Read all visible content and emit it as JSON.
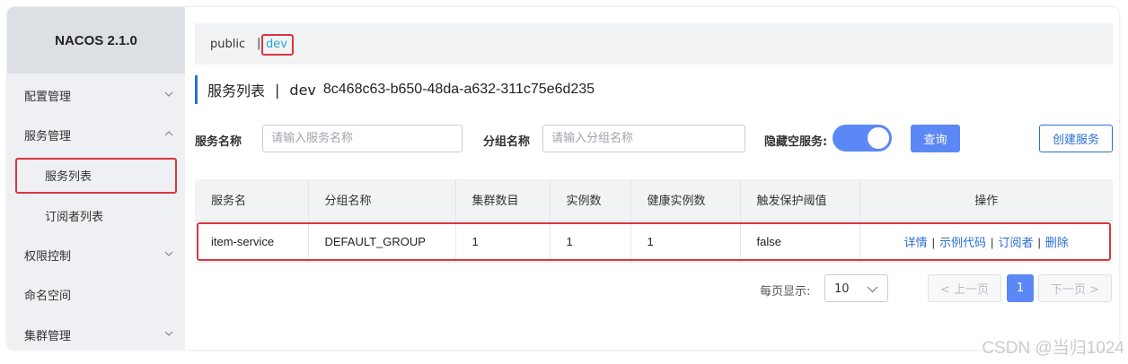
{
  "app": {
    "logo": "NACOS 2.1.0"
  },
  "sidebar": {
    "items": [
      {
        "label": "配置管理",
        "chevron": "down"
      },
      {
        "label": "服务管理",
        "chevron": "up"
      },
      {
        "label": "服务列表",
        "sub": true,
        "selected": true
      },
      {
        "label": "订阅者列表",
        "sub": true
      },
      {
        "label": "权限控制",
        "chevron": "down"
      },
      {
        "label": "命名空间"
      },
      {
        "label": "集群管理",
        "chevron": "down"
      }
    ]
  },
  "namespace": {
    "public": "public",
    "separator": "|",
    "dev": "dev",
    "active": "dev"
  },
  "page": {
    "title": "服务列表",
    "separator": "|",
    "ns_name": "dev",
    "ns_id": "8c468c63-b650-48da-a632-311c75e6d235"
  },
  "filters": {
    "service_name_label": "服务名称",
    "service_name_placeholder": "请输入服务名称",
    "group_name_label": "分组名称",
    "group_name_placeholder": "请输入分组名称",
    "hide_empty_label": "隐藏空服务:",
    "hide_empty_on": true,
    "query_label": "查询",
    "create_label": "创建服务"
  },
  "table": {
    "headers": [
      "服务名",
      "分组名称",
      "集群数目",
      "实例数",
      "健康实例数",
      "触发保护阈值",
      "操作"
    ],
    "rows": [
      {
        "service": "item-service",
        "group": "DEFAULT_GROUP",
        "clusters": "1",
        "instances": "1",
        "healthy": "1",
        "threshold": "false",
        "ops": [
          "详情",
          "示例代码",
          "订阅者",
          "删除"
        ],
        "ops_separator": "|"
      }
    ]
  },
  "pagination": {
    "per_page_label": "每页显示:",
    "per_page": "10",
    "prev": "< 上一页",
    "current": "1",
    "next": "下一页 >"
  },
  "watermark": "CSDN @当归1024",
  "colors": {
    "accent": "#5b88f5",
    "link": "#2b6fd6",
    "highlight": "#d9363e",
    "ns_active": "#29a3d9"
  }
}
